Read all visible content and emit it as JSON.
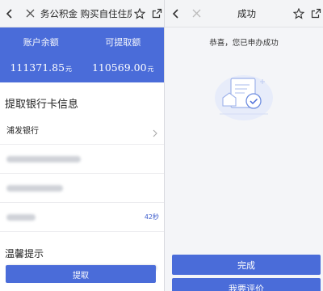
{
  "left": {
    "nav": {
      "title": "务公积金    购买自住住房提"
    },
    "balance": {
      "account_label": "账户余额",
      "account_value": "111371.85",
      "withdrawable_label": "可提取额",
      "withdrawable_value": "110569.00",
      "unit": "元"
    },
    "bank_section": {
      "title": "提取银行卡信息",
      "bank_name": "浦发银行",
      "countdown": "42秒"
    },
    "tips": {
      "title": "温馨提示"
    },
    "withdraw_button": "提取"
  },
  "right": {
    "nav": {
      "title": "成功"
    },
    "message": "恭喜，您已申办成功",
    "done_button": "完成",
    "rate_button": "我要评价"
  },
  "colors": {
    "primary": "#4a6cd9",
    "accent_text": "#3b5bcc"
  }
}
